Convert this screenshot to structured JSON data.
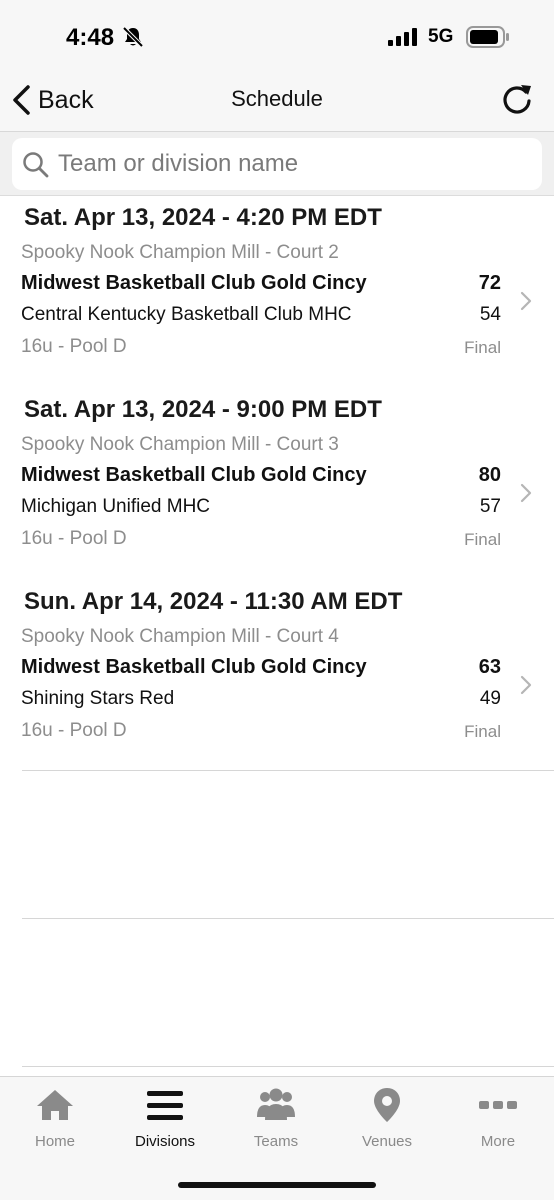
{
  "status_bar": {
    "time": "4:48",
    "network": "5G",
    "icons": [
      "bell-slash-icon",
      "signal-icon",
      "battery-icon"
    ]
  },
  "nav": {
    "back_label": "Back",
    "title": "Schedule",
    "refresh_icon": "refresh-icon"
  },
  "search": {
    "placeholder": "Team or division name",
    "value": ""
  },
  "games": [
    {
      "header": "Sat. Apr 13, 2024 - 4:20 PM EDT",
      "venue": "Spooky Nook Champion Mill - Court 2",
      "team1": "Midwest Basketball Club Gold Cincy",
      "score1": "72",
      "team2": "Central Kentucky Basketball Club MHC",
      "score2": "54",
      "division": "16u - Pool D",
      "status": "Final"
    },
    {
      "header": "Sat. Apr 13, 2024 - 9:00 PM EDT",
      "venue": "Spooky Nook Champion Mill - Court 3",
      "team1": "Midwest Basketball Club Gold Cincy",
      "score1": "80",
      "team2": "Michigan Unified MHC",
      "score2": "57",
      "division": "16u - Pool D",
      "status": "Final"
    },
    {
      "header": "Sun. Apr 14, 2024 - 11:30 AM EDT",
      "venue": "Spooky Nook Champion Mill - Court 4",
      "team1": "Midwest Basketball Club Gold Cincy",
      "score1": "63",
      "team2": "Shining Stars Red",
      "score2": "49",
      "division": "16u - Pool D",
      "status": "Final"
    }
  ],
  "tabs": [
    {
      "label": "Home",
      "icon": "home-icon",
      "active": false
    },
    {
      "label": "Divisions",
      "icon": "menu-icon",
      "active": true
    },
    {
      "label": "Teams",
      "icon": "people-icon",
      "active": false
    },
    {
      "label": "Venues",
      "icon": "location-pin-icon",
      "active": false
    },
    {
      "label": "More",
      "icon": "more-dots-icon",
      "active": false
    }
  ],
  "colors": {
    "bar_background": "#f7f7f7",
    "secondary_text": "#8d8d8d",
    "inactive_tab": "#8a8a8a"
  }
}
